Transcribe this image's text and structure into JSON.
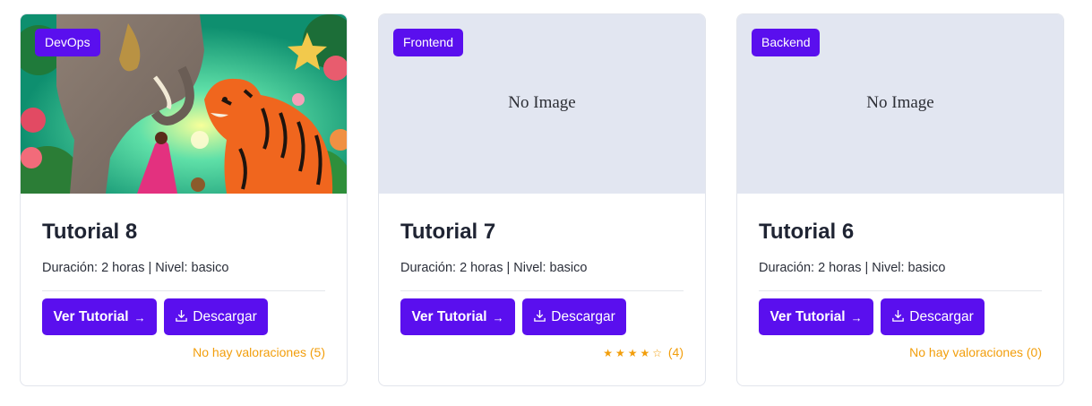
{
  "colors": {
    "accent": "#5a0fee",
    "rating": "#f29e0b",
    "placeholder_bg": "#e2e6f1"
  },
  "cards": [
    {
      "category": "DevOps",
      "has_image": true,
      "image_icon": "illustration-girl-elephant-tiger",
      "no_image_text": "",
      "title": "Tutorial 8",
      "meta": "Duración: 2 horas | Nivel: basico",
      "view_label": "Ver Tutorial",
      "view_arrow": "→",
      "download_icon": "download-icon",
      "download_label": "Descargar",
      "stars": "",
      "rating_text": "No hay valoraciones (5)"
    },
    {
      "category": "Frontend",
      "has_image": false,
      "no_image_text": "No Image",
      "title": "Tutorial 7",
      "meta": "Duración: 2 horas | Nivel: basico",
      "view_label": "Ver Tutorial",
      "view_arrow": "→",
      "download_icon": "download-icon",
      "download_label": "Descargar",
      "stars": "★★★★☆",
      "rating_text": "(4)"
    },
    {
      "category": "Backend",
      "has_image": false,
      "no_image_text": "No Image",
      "title": "Tutorial 6",
      "meta": "Duración: 2 horas | Nivel: basico",
      "view_label": "Ver Tutorial",
      "view_arrow": "→",
      "download_icon": "download-icon",
      "download_label": "Descargar",
      "stars": "",
      "rating_text": "No hay valoraciones (0)"
    }
  ]
}
